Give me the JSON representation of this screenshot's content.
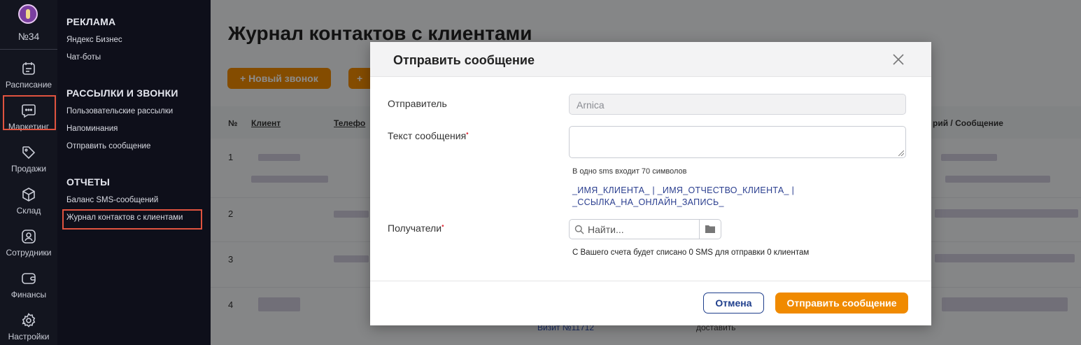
{
  "branch": {
    "label": "№34"
  },
  "rail": {
    "items": [
      {
        "label": "Расписание",
        "icon": "calendar-icon"
      },
      {
        "label": "Маркетинг",
        "icon": "chat-bubble-icon"
      },
      {
        "label": "Продажи",
        "icon": "tag-icon"
      },
      {
        "label": "Склад",
        "icon": "box-icon"
      },
      {
        "label": "Сотрудники",
        "icon": "person-icon"
      },
      {
        "label": "Финансы",
        "icon": "wallet-icon"
      },
      {
        "label": "Настройки",
        "icon": "gear-icon"
      }
    ]
  },
  "submenu": {
    "sections": [
      {
        "title": "РЕКЛАМА",
        "items": [
          "Яндекс Бизнес",
          "Чат-боты"
        ]
      },
      {
        "title": "РАССЫЛКИ И ЗВОНКИ",
        "items": [
          "Пользовательские рассылки",
          "Напоминания",
          "Отправить сообщение"
        ]
      },
      {
        "title": "ОТЧЕТЫ",
        "items": [
          "Баланс SMS-сообщений",
          "Журнал контактов с клиентами"
        ]
      }
    ]
  },
  "page": {
    "title": "Журнал контактов с клиентами",
    "new_call_label": "+  Новый звонок",
    "second_button_label": "+",
    "columns": {
      "num": "№",
      "client": "Клиент",
      "phone": "Телефо",
      "comment": "рий / Сообщение"
    },
    "rows": [
      "1",
      "2",
      "3",
      "4"
    ],
    "visit_link": "Визит №11712",
    "deliver_text": "доставить"
  },
  "modal": {
    "title": "Отправить сообщение",
    "sender_label": "Отправитель",
    "sender_value": "Arnica",
    "text_label": "Текст сообщения",
    "hint": "В одно sms входит 70 символов",
    "tags_line1": "_ИМЯ_КЛИЕНТА_ | _ИМЯ_ОТЧЕСТВО_КЛИЕНТА_ |",
    "tags_line2": "_ССЫЛКА_НА_ОНЛАЙН_ЗАПИСЬ_",
    "recipients_label": "Получатели",
    "search_placeholder": "Найти...",
    "sms_note": "С Вашего счета будет списано 0 SMS для отправки 0 клиентам",
    "cancel_label": "Отмена",
    "send_label": "Отправить сообщение"
  },
  "colors": {
    "accent": "#f08a00",
    "dark_nav": "#13151f",
    "highlight": "#e0533f",
    "link": "#2a3e8f"
  }
}
